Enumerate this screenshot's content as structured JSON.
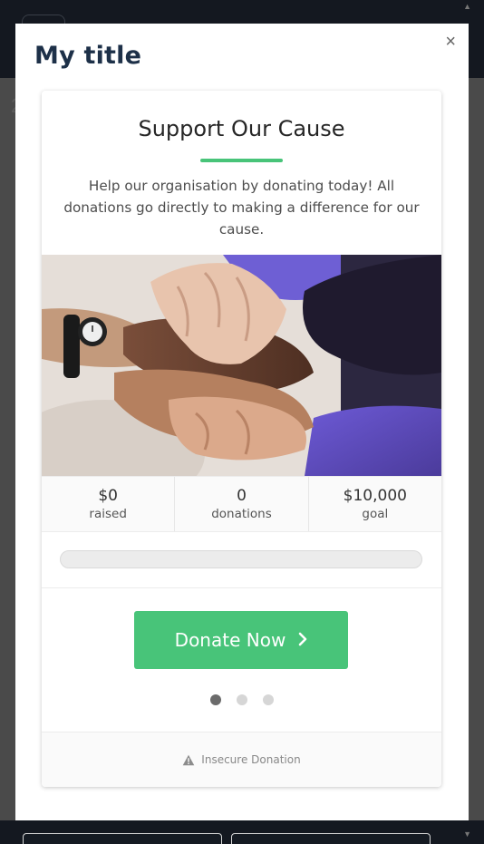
{
  "modal": {
    "title": "My title",
    "close_label": "×"
  },
  "campaign": {
    "heading": "Support Our Cause",
    "description": "Help our organisation by donating today! All donations go directly to making a difference for our cause.",
    "image_alt": "hands stacked together",
    "stats": [
      {
        "value": "$0",
        "label": "raised"
      },
      {
        "value": "0",
        "label": "donations"
      },
      {
        "value": "$10,000",
        "label": "goal"
      }
    ],
    "progress_fraction": 0,
    "donate_label": "Donate Now",
    "donate_icon": "chevron-right-icon",
    "pager": {
      "count": 3,
      "active": 0
    },
    "footer": {
      "icon": "warning-triangle-icon",
      "text": "Insecure Donation"
    }
  },
  "colors": {
    "accent": "#48c479",
    "heading": "#1d3048",
    "dot_active": "#6b6b6b",
    "dot_inactive": "#d6d6d6"
  }
}
